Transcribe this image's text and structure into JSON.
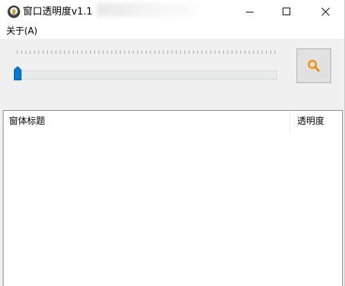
{
  "window": {
    "title": "窗口透明度v1.1"
  },
  "menu": {
    "about": "关于(A)"
  },
  "slider": {
    "value_fraction": 0.0
  },
  "list": {
    "columns": [
      "窗体标题",
      "透明度"
    ],
    "rows": []
  },
  "colors": {
    "accent": "#0078d7",
    "search_icon": "#ef8a00"
  }
}
